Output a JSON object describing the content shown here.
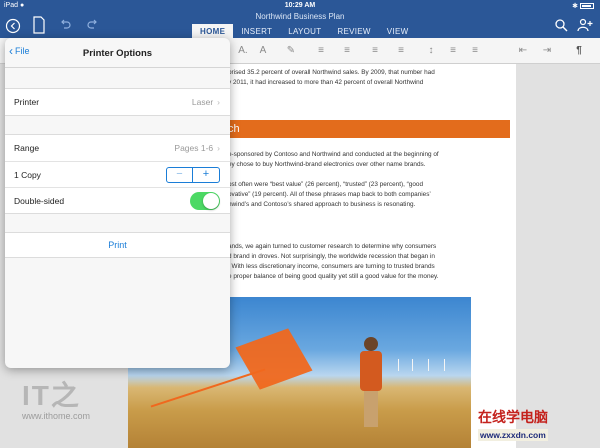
{
  "status_bar": {
    "device": "iPad",
    "wifi_icon": "wifi-icon",
    "time": "10:29 AM",
    "battery_icon": "battery-icon",
    "bluetooth_icon": "bluetooth-icon"
  },
  "title_bar": {
    "document_title": "Northwind Business Plan",
    "tabs": [
      {
        "label": "HOME",
        "active": true
      },
      {
        "label": "INSERT",
        "active": false
      },
      {
        "label": "LAYOUT",
        "active": false
      },
      {
        "label": "REVIEW",
        "active": false
      },
      {
        "label": "VIEW",
        "active": false
      }
    ]
  },
  "document": {
    "lines_top": [
      "prised 35.2 percent of overall Northwind sales. By 2009, that number had",
      "y 2011, it had increased to more than 42 percent of overall Northwind"
    ],
    "heading": "ch",
    "lines_mid": [
      "e-sponsored by Contoso and Northwind and conducted at the beginning of",
      "ey chose to buy Northwind-brand electronics over other name brands.",
      "",
      "ost often were “best value” (26 percent), “trusted” (23 percent), “good",
      "ovative” (19 percent). All of these phrases map back to both companies’",
      "hwind’s and Contoso’s shared approach to business is resonating."
    ],
    "lines_bottom": [
      "ands, we again turned to customer research to determine why consumers",
      "d brand in droves. Not surprisingly, the worldwide recession that began in",
      ". With less discretionary income, consumers are turning to trusted brands",
      "e proper balance of being good quality yet still a good value for the money."
    ]
  },
  "popover": {
    "back_label": "File",
    "title": "Printer Options",
    "printer": {
      "label": "Printer",
      "value": "Laser"
    },
    "range": {
      "label": "Range",
      "value": "Pages 1-6"
    },
    "copies": {
      "label": "1 Copy",
      "minus": "−",
      "plus": "+"
    },
    "double_sided": {
      "label": "Double-sided",
      "on": true
    },
    "print_label": "Print"
  },
  "watermarks": {
    "logo_text": "IT之",
    "site": "www.ithome.com",
    "cn_title": "在线学电脑",
    "cn_url": "www.zxxdn.com"
  },
  "colors": {
    "accent": "#2b5797",
    "heading": "#e36c1c",
    "ios_blue": "#1a7dd7",
    "toggle_on": "#4cd964"
  }
}
